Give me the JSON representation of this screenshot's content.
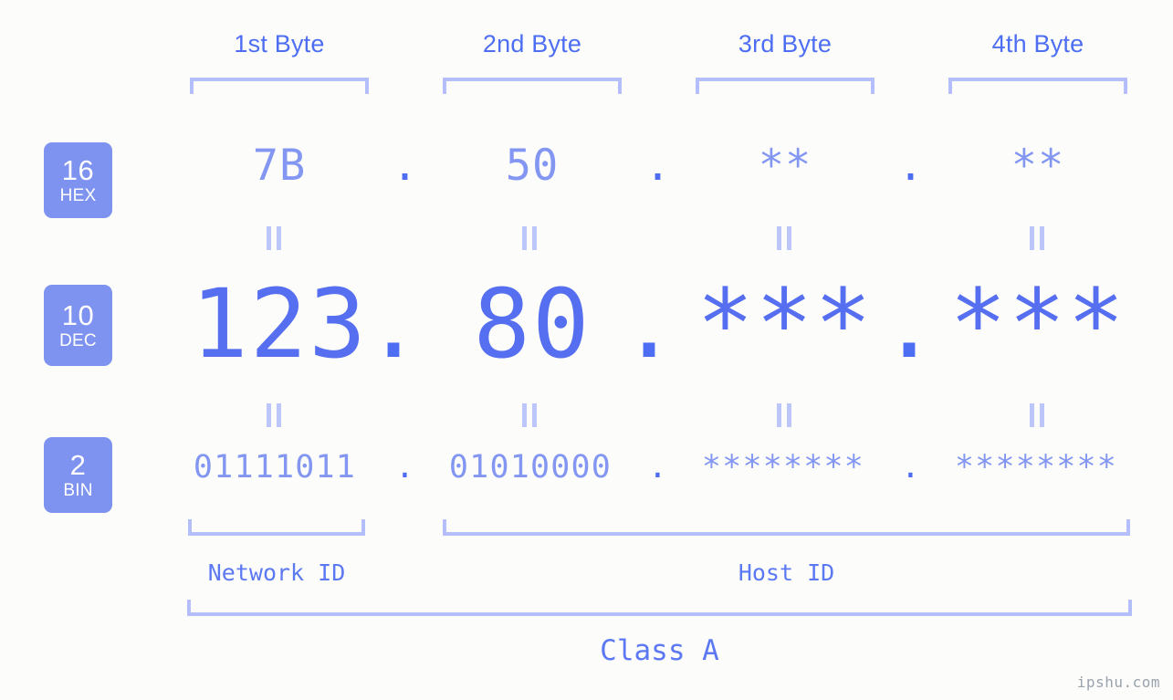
{
  "page": {
    "background_color": "#fcfdfa",
    "accent_dark": "#4d6ef2",
    "accent_light": "#8296f2",
    "bracket_color": "#b3befa",
    "badge_color": "#7e93ef",
    "watermark": "ipshu.com"
  },
  "byte_headers": [
    {
      "label": "1st Byte"
    },
    {
      "label": "2nd Byte"
    },
    {
      "label": "3rd Byte"
    },
    {
      "label": "4th Byte"
    }
  ],
  "bases": [
    {
      "num": "16",
      "label": "HEX"
    },
    {
      "num": "10",
      "label": "DEC"
    },
    {
      "num": "2",
      "label": "BIN"
    }
  ],
  "rows": {
    "hex": {
      "base_num": "16",
      "base_label": "HEX",
      "values": [
        "7B",
        "50",
        "**",
        "**"
      ],
      "separators": [
        ".",
        ".",
        "."
      ]
    },
    "dec": {
      "base_num": "10",
      "base_label": "DEC",
      "values": [
        "123",
        "80",
        "***",
        "***"
      ],
      "separators": [
        ".",
        ".",
        "."
      ]
    },
    "bin": {
      "base_num": "2",
      "base_label": "BIN",
      "values": [
        "01111011",
        "01010000",
        "********",
        "********"
      ],
      "separators": [
        ".",
        ".",
        "."
      ]
    }
  },
  "equals_markers": {
    "glyph": "=",
    "count_per_row": 4,
    "rows": 2
  },
  "spans": {
    "network_id": "Network ID",
    "host_id": "Host ID",
    "class": "Class A"
  }
}
